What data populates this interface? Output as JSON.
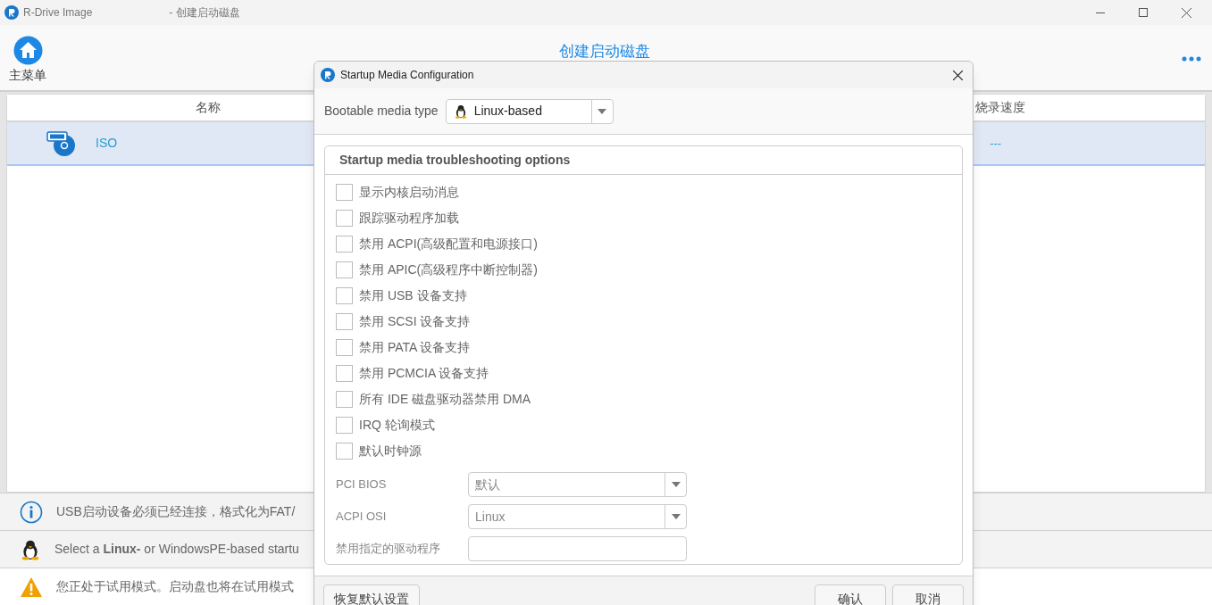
{
  "window": {
    "app_name": "R-Drive Image",
    "title": "- 创建启动磁盘"
  },
  "toolbar": {
    "home_label": "主菜单",
    "page_title": "创建启动磁盘"
  },
  "table": {
    "columns": [
      "名称",
      "烧录速度"
    ],
    "rows": [
      {
        "name": "ISO",
        "speed": "---",
        "selected": true
      }
    ]
  },
  "messages": [
    {
      "kind": "info",
      "text": "USB启动设备必须已经连接，格式化为FAT/"
    },
    {
      "kind": "linux",
      "text": "Select a **Linux-** or WindowsPE-based startu"
    },
    {
      "kind": "warning",
      "text": "您正处于试用模式。启动盘也将在试用模式"
    }
  ],
  "dialog": {
    "title": "Startup Media Configuration",
    "media_type_label": "Bootable media type",
    "media_type": "Linux-based",
    "group_title": "Startup media troubleshooting options",
    "options": [
      {
        "label": "显示内核启动消息",
        "checked": false
      },
      {
        "label": "跟踪驱动程序加载",
        "checked": false
      },
      {
        "label": "禁用 ACPI(高级配置和电源接口)",
        "checked": false
      },
      {
        "label": "禁用 APIC(高级程序中断控制器)",
        "checked": false
      },
      {
        "label": "禁用 USB 设备支持",
        "checked": false
      },
      {
        "label": "禁用 SCSI 设备支持",
        "checked": false
      },
      {
        "label": "禁用 PATA 设备支持",
        "checked": false
      },
      {
        "label": "禁用 PCMCIA 设备支持",
        "checked": false
      },
      {
        "label": "所有 IDE 磁盘驱动器禁用 DMA",
        "checked": false
      },
      {
        "label": "IRQ 轮询模式",
        "checked": false
      },
      {
        "label": "默认时钟源",
        "checked": false
      }
    ],
    "fields": [
      {
        "kind": "dropdown",
        "label": "PCI BIOS",
        "value": "默认"
      },
      {
        "kind": "dropdown",
        "label": "ACPI OSI",
        "value": "Linux"
      },
      {
        "kind": "text",
        "label": "禁用指定的驱动程序"
      }
    ],
    "buttons": {
      "reset": "恢复默认设置",
      "ok": "确认",
      "cancel": "取消"
    }
  }
}
